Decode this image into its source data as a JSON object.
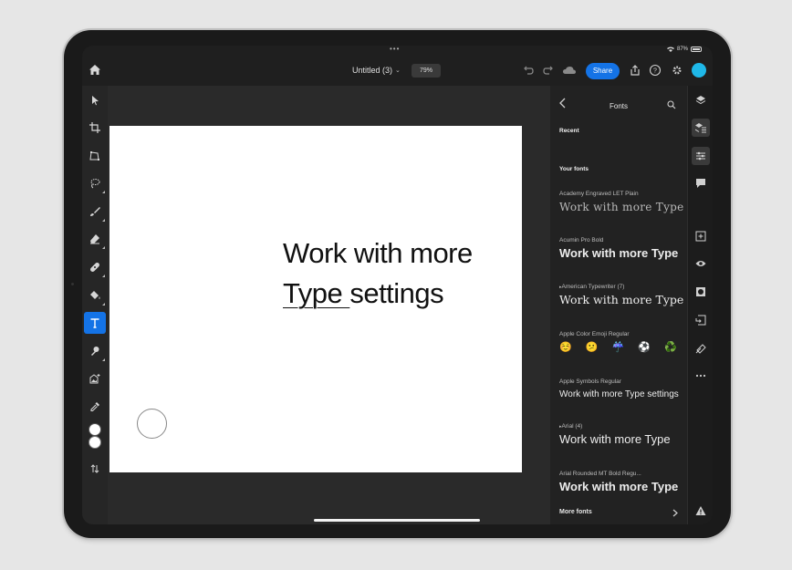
{
  "status": {
    "dots": "•••",
    "battery": "87%"
  },
  "document": {
    "title": "Untitled (3)",
    "zoom": "79%"
  },
  "toolbar": {
    "share_label": "Share"
  },
  "canvas": {
    "line1": "Work with more",
    "line2_underlined": "Type ",
    "line2_rest": "settings"
  },
  "fonts_panel": {
    "title": "Fonts",
    "recent_label": "Recent",
    "your_fonts_label": "Your fonts",
    "more_fonts_label": "More fonts",
    "fonts": [
      {
        "name": "Academy Engraved LET Plain",
        "sample": "Work with more  Type"
      },
      {
        "name": "Acumin Pro Bold",
        "sample": "Work with more  Type"
      },
      {
        "name": "American Typewriter (7)",
        "sample": "Work with more  Type"
      },
      {
        "name": "Apple Color Emoji Regular",
        "sample": "☺️  😕  ☔  ⚽  ♻️"
      },
      {
        "name": "Apple Symbols Regular",
        "sample": "Work with more   Type settings"
      },
      {
        "name": "Arial (4)",
        "sample": "Work with more  Type"
      },
      {
        "name": "Arial Rounded MT Bold Regu...",
        "sample": "Work with more  Type"
      }
    ]
  },
  "colors": {
    "accent": "#1473e6",
    "avatar": "#1fb8e8"
  }
}
